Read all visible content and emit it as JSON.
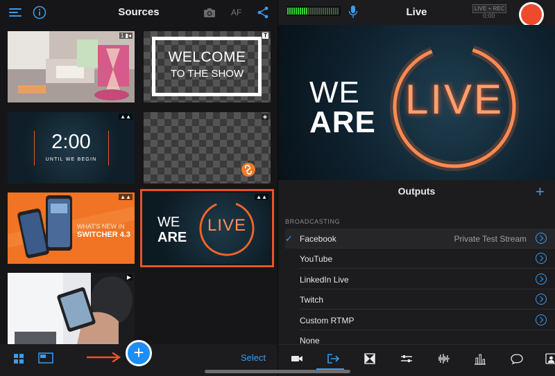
{
  "sources": {
    "title": "Sources",
    "af_label": "AF",
    "select_label": "Select",
    "add_symbol": "+",
    "tiles": {
      "welcome_line1": "WELCOME",
      "welcome_line2": "TO THE SHOW",
      "countdown_time": "2:00",
      "countdown_caption": "UNTIL WE BEGIN",
      "whatsnew_line1": "WHAT'S NEW IN",
      "whatsnew_line2": "SWITCHER 4.3",
      "weare_line1": "WE",
      "weare_line2": "ARE",
      "weare_live": "LIVE",
      "camera_badge": "1",
      "title_badge": "T"
    }
  },
  "live": {
    "title": "Live",
    "status_badge": "LIVE + REC",
    "timer": "0:00",
    "preview_line1": "WE",
    "preview_line2": "ARE",
    "preview_live": "LIVE"
  },
  "outputs": {
    "title": "Outputs",
    "add_symbol": "+",
    "section_header": "BROADCASTING",
    "items": [
      {
        "name": "Facebook",
        "detail": "Private Test Stream",
        "checked": "✓"
      },
      {
        "name": "YouTube"
      },
      {
        "name": "LinkedIn Live"
      },
      {
        "name": "Twitch"
      },
      {
        "name": "Custom RTMP"
      },
      {
        "name": "None"
      }
    ]
  },
  "colors": {
    "accent": "#3a9bf0",
    "selection": "#e8542b",
    "record": "#f04a2c",
    "neon": "#f0642a"
  }
}
